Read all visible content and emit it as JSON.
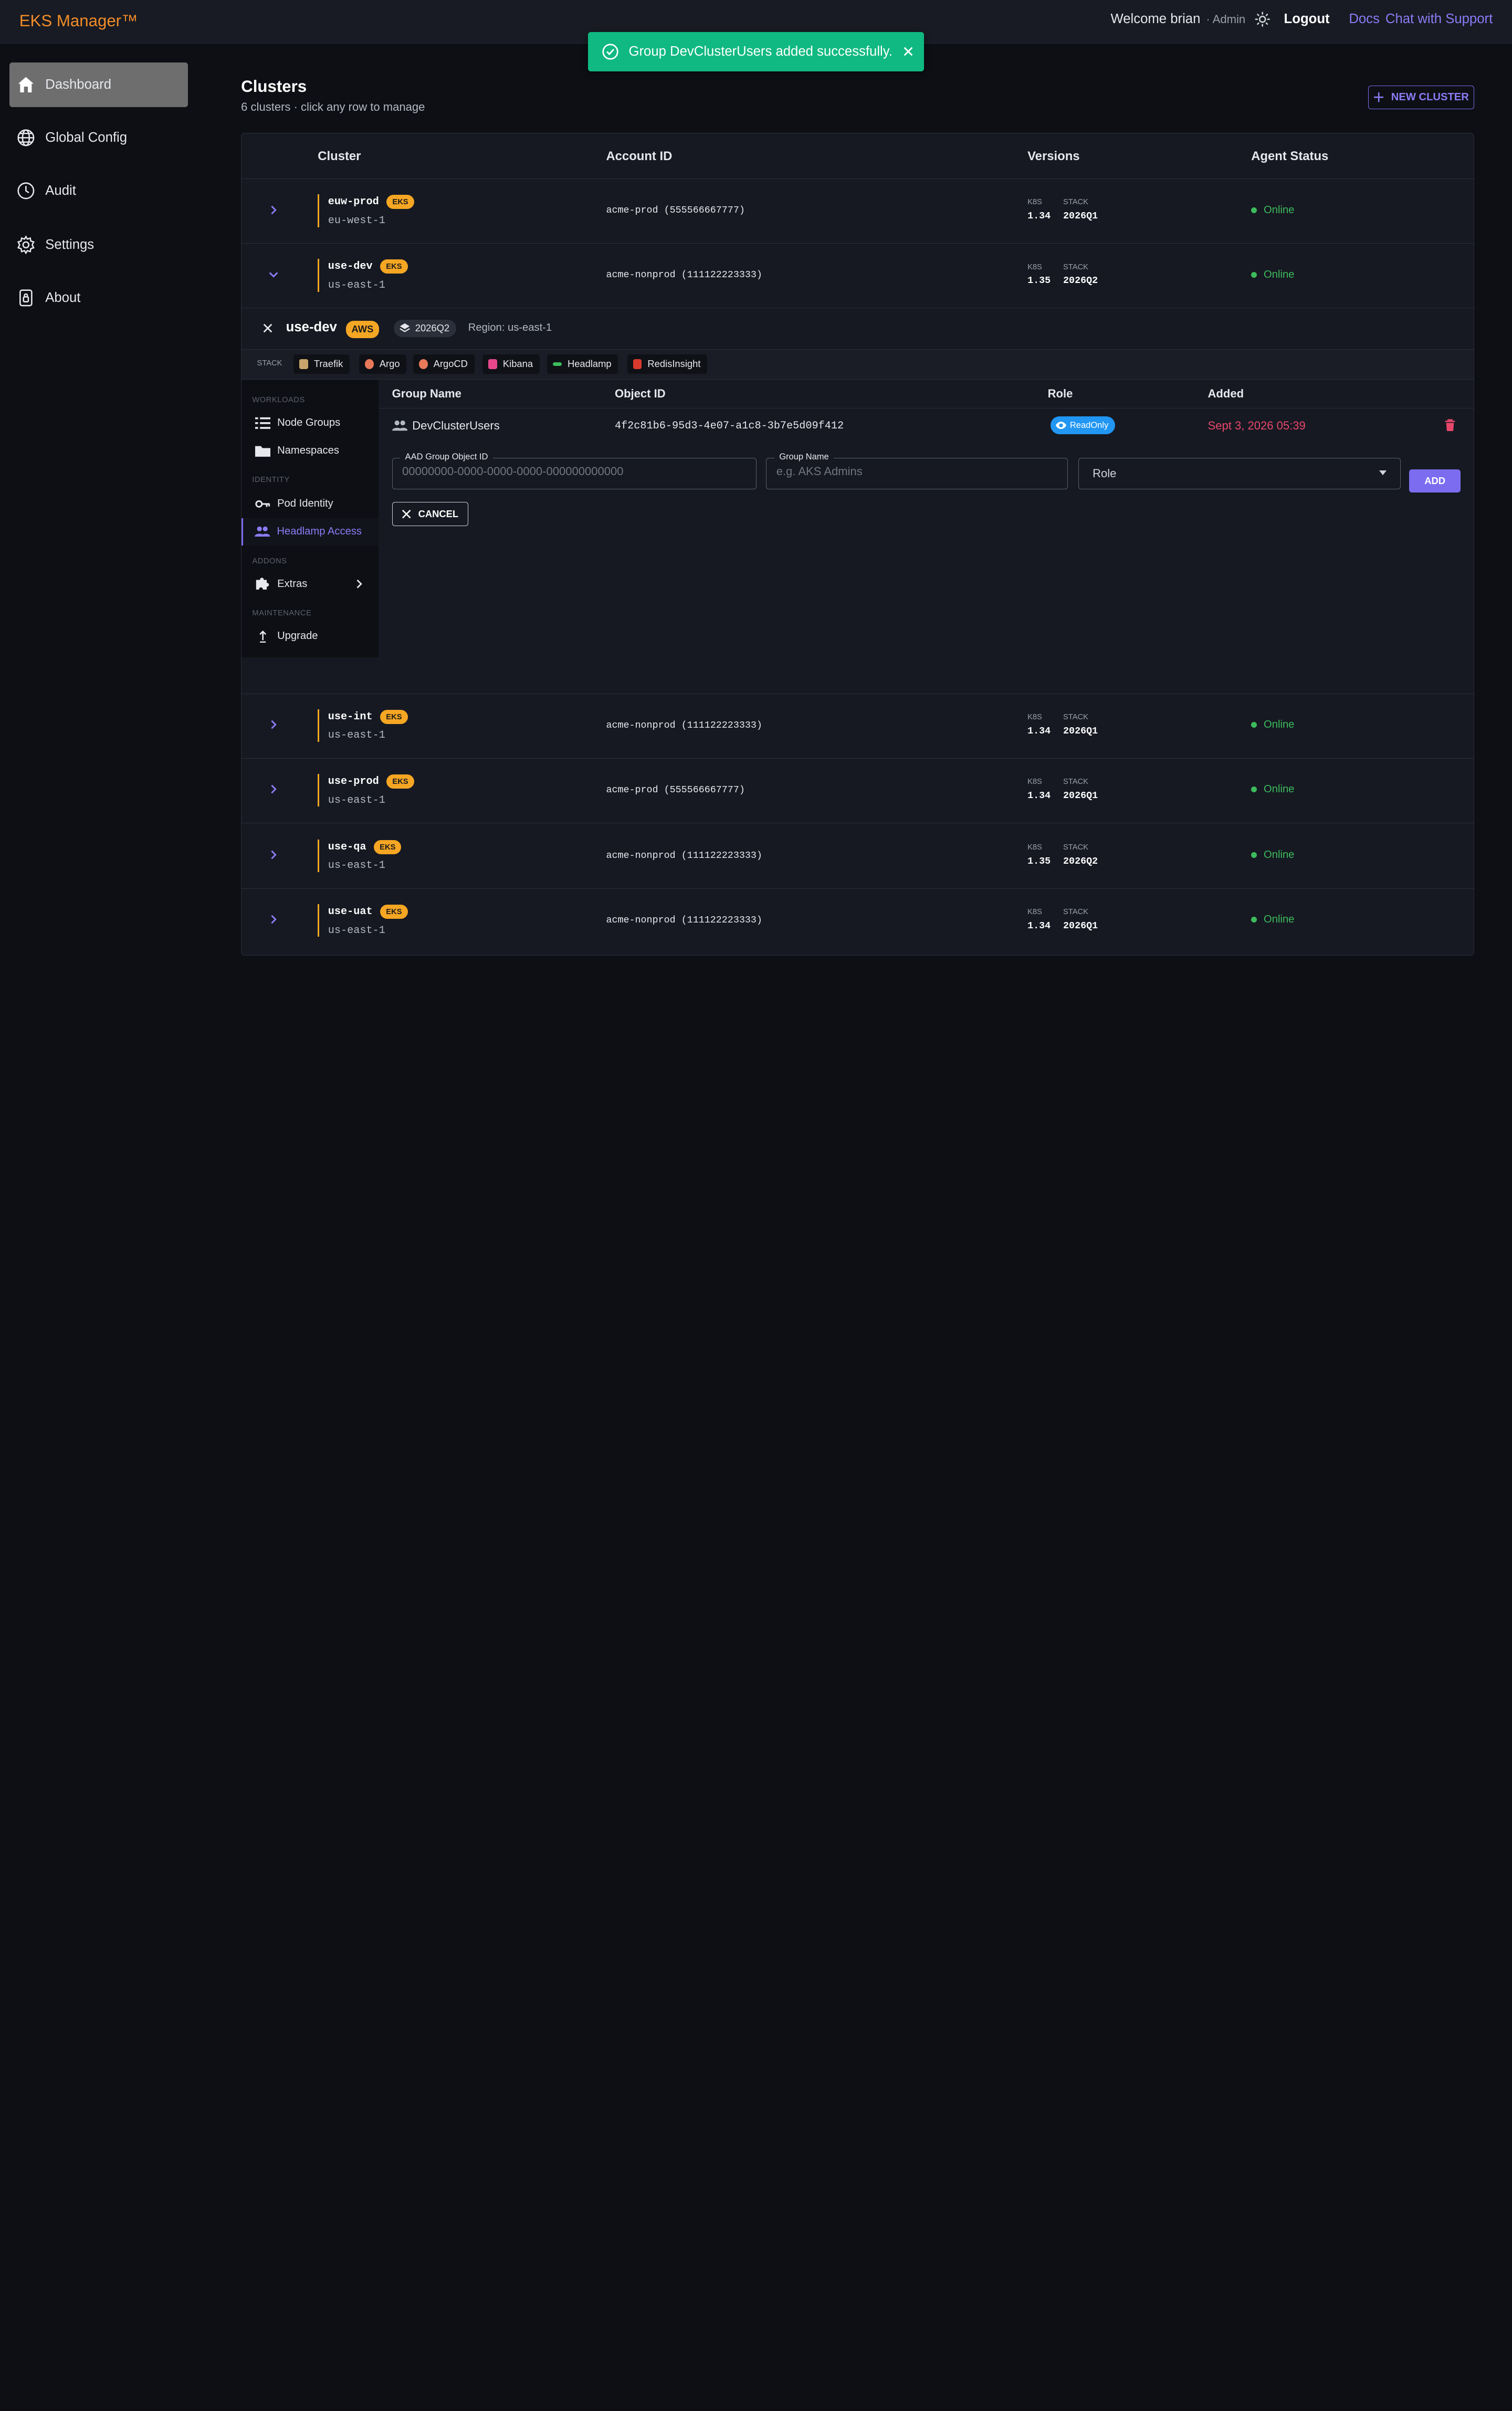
{
  "app": {
    "brand": "EKS Manager™"
  },
  "topbar": {
    "welcome": "Welcome brian",
    "role": "· Admin",
    "logout": "Logout",
    "docs": "Docs",
    "support": "Chat with Support"
  },
  "toast": {
    "message": "Group DevClusterUsers added successfully."
  },
  "sidebar": {
    "items": [
      {
        "label": "Dashboard",
        "icon": "home-icon",
        "active": true
      },
      {
        "label": "Global Config",
        "icon": "globe-icon"
      },
      {
        "label": "Audit",
        "icon": "clock-icon"
      },
      {
        "label": "Settings",
        "icon": "gear-icon"
      },
      {
        "label": "About",
        "icon": "lock-icon"
      }
    ]
  },
  "page": {
    "title": "Clusters",
    "subtitle": "6 clusters · click any row to manage",
    "new_cluster": "NEW CLUSTER"
  },
  "table": {
    "headers": {
      "cluster": "Cluster",
      "account": "Account ID",
      "versions": "Versions",
      "status": "Agent Status"
    },
    "k8s_label": "K8S",
    "stack_label": "STACK",
    "badge": "EKS",
    "rows": [
      {
        "name": "euw-prod",
        "region": "eu-west-1",
        "account": "acme-prod (555566667777)",
        "k8s": "1.34",
        "stack": "2026Q1",
        "status": "Online"
      },
      {
        "name": "use-dev",
        "region": "us-east-1",
        "account": "acme-nonprod (111122223333)",
        "k8s": "1.35",
        "stack": "2026Q2",
        "status": "Online"
      },
      {
        "name": "use-int",
        "region": "us-east-1",
        "account": "acme-nonprod (111122223333)",
        "k8s": "1.34",
        "stack": "2026Q1",
        "status": "Online"
      },
      {
        "name": "use-prod",
        "region": "us-east-1",
        "account": "acme-prod (555566667777)",
        "k8s": "1.34",
        "stack": "2026Q1",
        "status": "Online"
      },
      {
        "name": "use-qa",
        "region": "us-east-1",
        "account": "acme-nonprod (111122223333)",
        "k8s": "1.35",
        "stack": "2026Q2",
        "status": "Online"
      },
      {
        "name": "use-uat",
        "region": "us-east-1",
        "account": "acme-nonprod (111122223333)",
        "k8s": "1.34",
        "stack": "2026Q1",
        "status": "Online"
      }
    ]
  },
  "expanded": {
    "name": "use-dev",
    "provider": "AWS",
    "stack_version": "2026Q2",
    "region": "Region: us-east-1",
    "stack_label": "STACK",
    "stack_chips": [
      {
        "label": "Traefik",
        "color": "#c9a46a"
      },
      {
        "label": "Argo",
        "color": "#e8795a"
      },
      {
        "label": "ArgoCD",
        "color": "#e8795a"
      },
      {
        "label": "Kibana",
        "color": "#e8478b"
      },
      {
        "label": "Headlamp",
        "color": "#3dbb5c"
      },
      {
        "label": "RedisInsight",
        "color": "#d83a2e"
      }
    ],
    "nav": {
      "workloads": "WORKLOADS",
      "node_groups": "Node Groups",
      "namespaces": "Namespaces",
      "identity": "IDENTITY",
      "pod_identity": "Pod Identity",
      "headlamp_access": "Headlamp Access",
      "addons": "ADDONS",
      "extras": "Extras",
      "maintenance": "MAINTENANCE",
      "upgrade": "Upgrade"
    },
    "groups": {
      "headers": {
        "name": "Group Name",
        "object_id": "Object ID",
        "role": "Role",
        "added": "Added"
      },
      "rows": [
        {
          "name": "DevClusterUsers",
          "object_id": "4f2c81b6-95d3-4e07-a1c8-3b7e5d09f412",
          "role": "ReadOnly",
          "added": "Sept 3, 2026 05:39"
        }
      ]
    },
    "form": {
      "aad_label": "AAD Group Object ID",
      "aad_placeholder": "00000000-0000-0000-0000-000000000000",
      "group_label": "Group Name",
      "group_placeholder": "e.g. AKS Admins",
      "role_value": "Role",
      "add": "ADD",
      "cancel": "CANCEL"
    }
  },
  "colors": {
    "accent": "#7c6cf0",
    "brand": "#f28c28",
    "success": "#10b981",
    "online": "#3dbb5c",
    "badge": "#f5a623",
    "date": "#e8476b"
  }
}
